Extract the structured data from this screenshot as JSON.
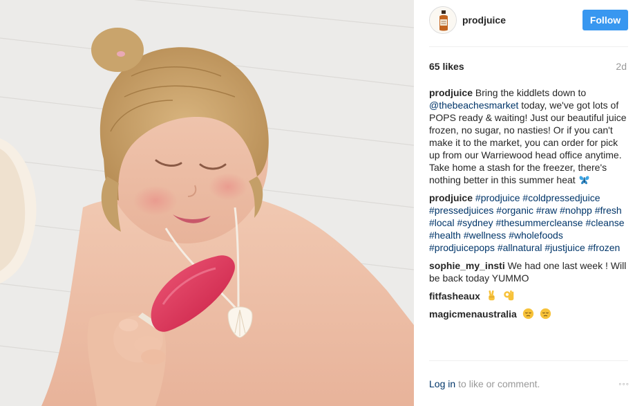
{
  "header": {
    "username": "prodjuice",
    "follow_label": "Follow",
    "avatar_icon": "juice-bottle-icon"
  },
  "stats": {
    "likes": "65 likes",
    "time_ago": "2d"
  },
  "caption": {
    "user": "prodjuice",
    "text_before": "Bring the kiddlets down to",
    "mention": "@thebeachesmarket",
    "text_after": "today, we've got lots of POPS ready & waiting! Just our beautiful juice frozen, no sugar, no nasties!  Or if you can't make it to the market, you can order for pick up from our Warriewood head office anytime. Take home a stash for the freezer, there's nothing better in this summer heat",
    "emoji": "butterfly-icon"
  },
  "comments": [
    {
      "user": "prodjuice",
      "hashtags": [
        "#prodjuice",
        "#coldpressedjuice",
        "#pressedjuices",
        "#organic",
        "#raw",
        "#nohpp",
        "#fresh",
        "#local",
        "#sydney",
        "#thesummercleanse",
        "#cleanse",
        "#health",
        "#wellness",
        "#wholefoods",
        "#prodjuicepops",
        "#allnatural",
        "#justjuice",
        "#frozen"
      ]
    },
    {
      "user": "sophie_my_insti",
      "text": "We had one last week ! Will be back today YUMMO"
    },
    {
      "user": "fitfasheaux",
      "emojis": [
        "victory-hand-icon",
        "ok-hand-icon"
      ]
    },
    {
      "user": "magicmenaustralia",
      "emojis": [
        "relieved-face-icon",
        "relieved-face-icon"
      ]
    }
  ],
  "footer": {
    "login_label": "Log in",
    "login_suffix": "to like or comment.",
    "more_label": "◦◦◦",
    "more_icon": "more-options-icon"
  },
  "colors": {
    "follow_button": "#3897f0",
    "link": "#003569",
    "muted": "#999999",
    "popsicle": "#d9294f"
  }
}
